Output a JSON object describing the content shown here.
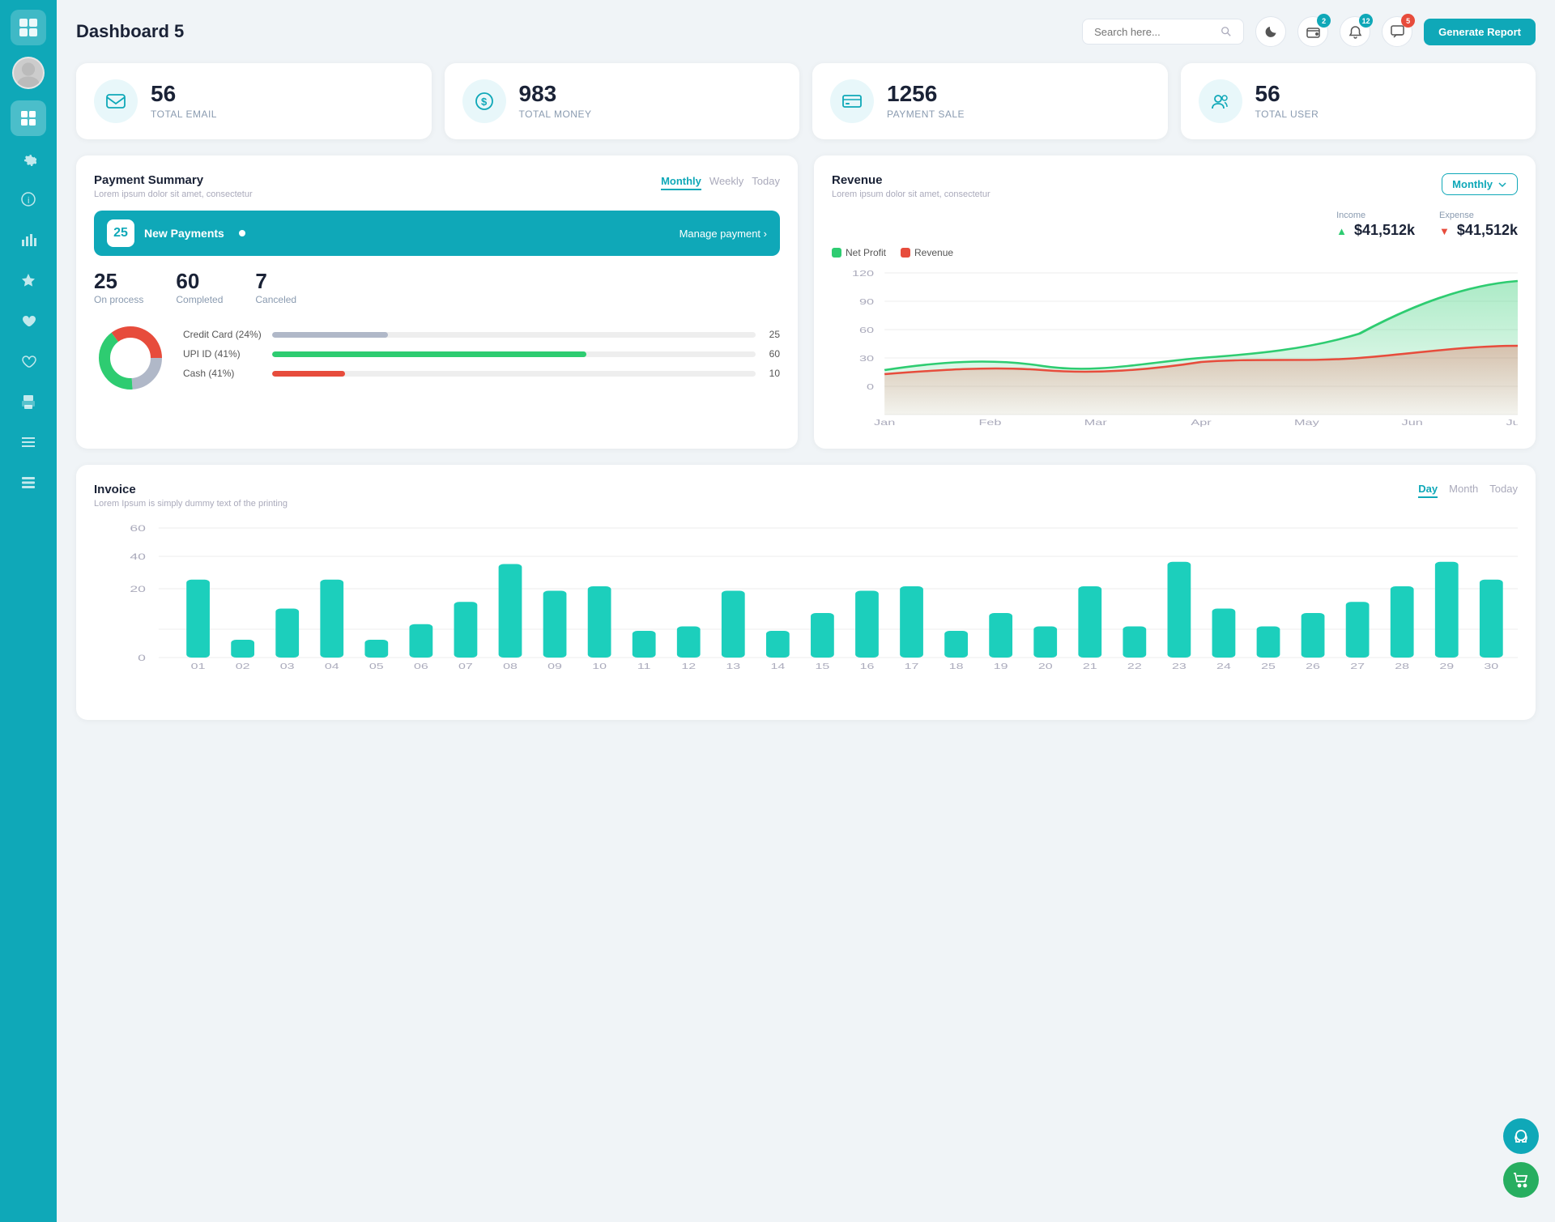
{
  "app": {
    "title": "Dashboard 5"
  },
  "header": {
    "search_placeholder": "Search here...",
    "generate_btn": "Generate Report",
    "badges": {
      "wallet": "2",
      "bell": "12",
      "chat": "5"
    }
  },
  "stats": [
    {
      "id": "email",
      "number": "56",
      "label": "TOTAL EMAIL",
      "icon": "email-icon"
    },
    {
      "id": "money",
      "number": "983",
      "label": "TOTAL MONEY",
      "icon": "money-icon"
    },
    {
      "id": "payment",
      "number": "1256",
      "label": "PAYMENT SALE",
      "icon": "payment-icon"
    },
    {
      "id": "user",
      "number": "56",
      "label": "TOTAL USER",
      "icon": "user-icon"
    }
  ],
  "payment_summary": {
    "title": "Payment Summary",
    "subtitle": "Lorem ipsum dolor sit amet, consectetur",
    "tabs": [
      "Monthly",
      "Weekly",
      "Today"
    ],
    "active_tab": "Monthly",
    "new_payments_count": "25",
    "new_payments_label": "New Payments",
    "manage_link": "Manage payment",
    "stats": {
      "on_process": {
        "num": "25",
        "label": "On process"
      },
      "completed": {
        "num": "60",
        "label": "Completed"
      },
      "canceled": {
        "num": "7",
        "label": "Canceled"
      }
    },
    "methods": [
      {
        "label": "Credit Card (24%)",
        "percent": 24,
        "color": "#b0b8c8",
        "count": "25"
      },
      {
        "label": "UPI ID (41%)",
        "percent": 65,
        "color": "#2ecc71",
        "count": "60"
      },
      {
        "label": "Cash (41%)",
        "percent": 15,
        "color": "#e74c3c",
        "count": "10"
      }
    ],
    "donut": {
      "segments": [
        {
          "color": "#b0b8c8",
          "percent": 24
        },
        {
          "color": "#2ecc71",
          "percent": 41
        },
        {
          "color": "#e74c3c",
          "percent": 35
        }
      ]
    }
  },
  "revenue": {
    "title": "Revenue",
    "subtitle": "Lorem ipsum dolor sit amet, consectetur",
    "active_tab": "Monthly",
    "income": {
      "label": "Income",
      "value": "$41,512k",
      "icon": "up-icon"
    },
    "expense": {
      "label": "Expense",
      "value": "$41,512k",
      "icon": "down-icon"
    },
    "legend": [
      {
        "label": "Net Profit",
        "color": "#2ecc71"
      },
      {
        "label": "Revenue",
        "color": "#e74c3c"
      }
    ],
    "x_labels": [
      "Jan",
      "Feb",
      "Mar",
      "Apr",
      "May",
      "Jun",
      "July"
    ],
    "y_labels": [
      "120",
      "90",
      "60",
      "30",
      "0"
    ]
  },
  "invoice": {
    "title": "Invoice",
    "subtitle": "Lorem Ipsum is simply dummy text of the printing",
    "tabs": [
      "Day",
      "Month",
      "Today"
    ],
    "active_tab": "Day",
    "y_labels": [
      "60",
      "40",
      "20",
      "0"
    ],
    "x_labels": [
      "01",
      "02",
      "03",
      "04",
      "05",
      "06",
      "07",
      "08",
      "09",
      "10",
      "11",
      "12",
      "13",
      "14",
      "15",
      "16",
      "17",
      "18",
      "19",
      "20",
      "21",
      "22",
      "23",
      "24",
      "25",
      "26",
      "27",
      "28",
      "29",
      "30"
    ],
    "bars": [
      35,
      8,
      22,
      35,
      8,
      15,
      25,
      42,
      30,
      32,
      12,
      14,
      30,
      12,
      20,
      30,
      32,
      12,
      20,
      14,
      32,
      14,
      43,
      22,
      14,
      20,
      25,
      32,
      43,
      35
    ]
  },
  "sidebar": {
    "items": [
      {
        "id": "dashboard",
        "icon": "grid-icon",
        "active": true
      },
      {
        "id": "settings",
        "icon": "gear-icon",
        "active": false
      },
      {
        "id": "info",
        "icon": "info-icon",
        "active": false
      },
      {
        "id": "chart",
        "icon": "chart-icon",
        "active": false
      },
      {
        "id": "star",
        "icon": "star-icon",
        "active": false
      },
      {
        "id": "heart-filled",
        "icon": "heart-filled-icon",
        "active": false
      },
      {
        "id": "heart",
        "icon": "heart-icon",
        "active": false
      },
      {
        "id": "print",
        "icon": "print-icon",
        "active": false
      },
      {
        "id": "menu",
        "icon": "menu-icon",
        "active": false
      },
      {
        "id": "list",
        "icon": "list-icon",
        "active": false
      }
    ]
  }
}
